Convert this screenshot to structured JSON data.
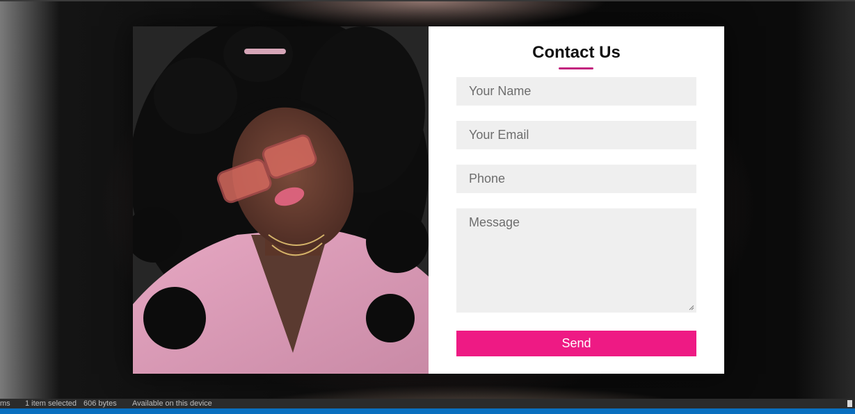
{
  "contact_form": {
    "title": "Contact Us",
    "name_placeholder": "Your Name",
    "email_placeholder": "Your Email",
    "phone_placeholder": "Phone",
    "message_placeholder": "Message",
    "send_label": "Send"
  },
  "status_bar": {
    "problems": "ms",
    "selection": "1 item selected",
    "size": "606 bytes",
    "availability": "Available on this device"
  },
  "colors": {
    "accent": "#ee1a84",
    "underline": "#c2227e",
    "field_bg": "#efefef",
    "status_blue": "#0a6fbf"
  },
  "icons": {
    "resize_grip": "resize-grip-icon"
  }
}
